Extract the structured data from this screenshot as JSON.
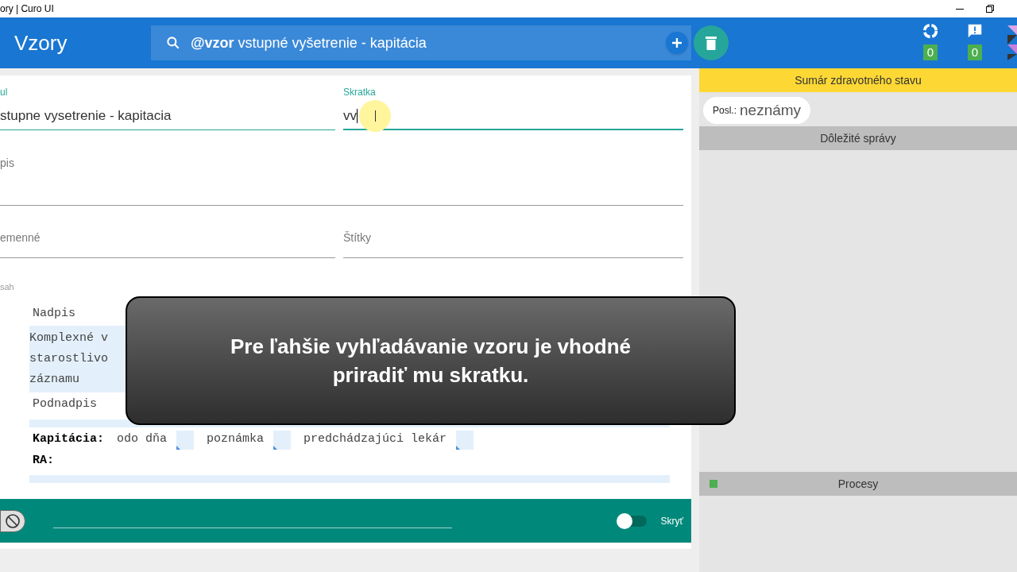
{
  "window": {
    "title": "ory | Curo UI"
  },
  "header": {
    "title": "Vzory",
    "search": {
      "value": "**@vzor** vstupné vyšetrenie - kapitácia"
    },
    "indicators": [
      {
        "kind": "sync",
        "count": "0"
      },
      {
        "kind": "alert",
        "count": "0"
      }
    ]
  },
  "form": {
    "row1": [
      {
        "label": "ul",
        "value": "stupne vysetrenie - kapitacia",
        "focused": false
      },
      {
        "label": "Skratka",
        "value": "vv",
        "focused": true
      }
    ],
    "description": {
      "label": "pis"
    },
    "row3": [
      {
        "label": "emenné"
      },
      {
        "label": "Štítky"
      }
    ],
    "content_label": "sah",
    "editor": [
      {
        "kind": "heading",
        "text": "Nadpis"
      },
      {
        "kind": "block",
        "lines": [
          "Komplexné v",
          "starostlivo",
          "záznamu"
        ]
      },
      {
        "kind": "heading",
        "text": "Podnadpis"
      },
      {
        "kind": "empty_block"
      },
      {
        "kind": "fields",
        "label": "Kapitácia:",
        "items": [
          "odo dňa",
          "poznámka",
          "predchádzajúci lekár"
        ]
      },
      {
        "kind": "label",
        "text": "RA:"
      },
      {
        "kind": "empty_block"
      }
    ]
  },
  "footer": {
    "toggle": {
      "label": "Skryť",
      "on": false
    }
  },
  "tooltip": {
    "text": "Pre ľahšie vyhľadávanie vzoru je vhodné priradiť mu skratku."
  },
  "right_panel": {
    "summary_title": "Sumár zdravotného stavu",
    "chip": {
      "label": "Posl.:",
      "value": "neznámy"
    },
    "messages_title": "Dôležité správy",
    "processes": {
      "title": "Procesy",
      "color": "#4caf50"
    }
  }
}
